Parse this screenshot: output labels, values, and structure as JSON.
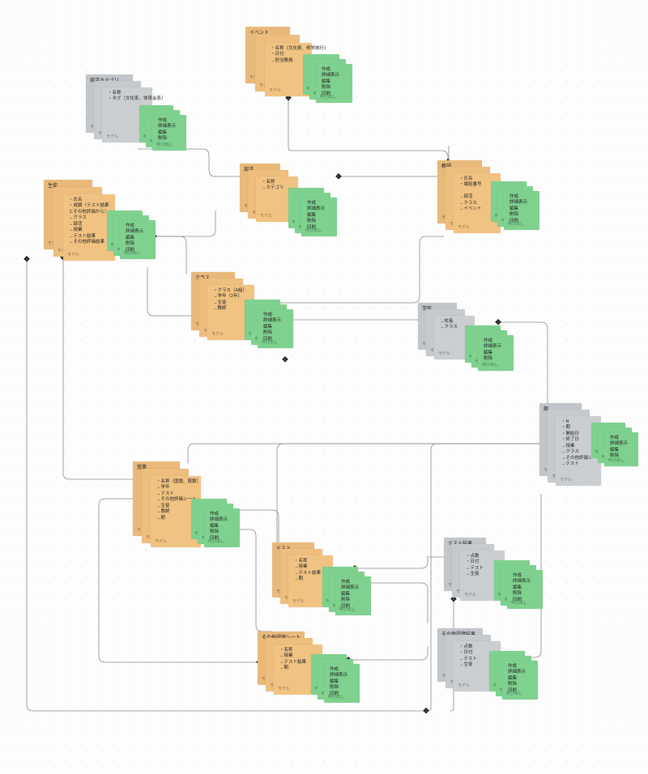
{
  "footer_model": "モデル",
  "footer_crud": "呼び出し",
  "crud_standard": [
    "作成",
    "詳細表示",
    "編集",
    "削除",
    "印刷"
  ],
  "crud_no_print": [
    "作成",
    "詳細表示",
    "編集",
    "削除"
  ],
  "anchor_glyph": "✥",
  "nodes": {
    "event": {
      "title": "イベント",
      "attrs": [
        "・名称（文化祭、修学旅行）",
        "・日付",
        "→担当教員"
      ]
    },
    "clubcat": {
      "title": "部活カテゴリ",
      "attrs": [
        "・名称",
        "・タグ（文化系、体育会系）"
      ]
    },
    "club": {
      "title": "部活",
      "attrs": [
        "・名称",
        "→カテゴリ"
      ]
    },
    "teacher": {
      "title": "教師",
      "attrs": [
        "・氏名",
        "・電話番号",
        "",
        "→部活",
        "→クラス",
        "→イベント"
      ]
    },
    "student": {
      "title": "生徒",
      "attrs": [
        "・氏名",
        "・成績（テスト結果とその他評価から）",
        "→クラス",
        "→部活",
        "→授業",
        "→テスト結果",
        "→その他評価結果"
      ]
    },
    "klass": {
      "title": "クラス",
      "attrs": [
        "・クラス（A組）",
        "→学年（2年）",
        "→生徒",
        "→教師"
      ]
    },
    "grade": {
      "title": "学年",
      "attrs": [
        "→校長",
        "→クラス"
      ]
    },
    "term": {
      "title": "期",
      "attrs": [
        "・N",
        "・期",
        "・開始日",
        "・終了日",
        "→授業",
        "→クラス",
        "→その他評価シート",
        "→テスト"
      ]
    },
    "lesson": {
      "title": "授業",
      "attrs": [
        "・名称（国語、算数）",
        "→学年",
        "→テスト",
        "→その他評価シート",
        "→生徒",
        "→教師",
        "→期"
      ]
    },
    "test": {
      "title": "テスト",
      "attrs": [
        "・名称",
        "→授業",
        "→テスト結果",
        "→期"
      ]
    },
    "testresult": {
      "title": "テスト結果",
      "attrs": [
        "・点数",
        "・日付",
        "→テスト",
        "→生徒"
      ]
    },
    "othersheet": {
      "title": "その他評価シート",
      "attrs": [
        "・名称",
        "→授業",
        "→テスト結果",
        "→期"
      ]
    },
    "otherresult": {
      "title": "その他評価結果",
      "attrs": [
        "・点数",
        "・日付",
        "→テスト",
        "→生徒"
      ]
    }
  }
}
